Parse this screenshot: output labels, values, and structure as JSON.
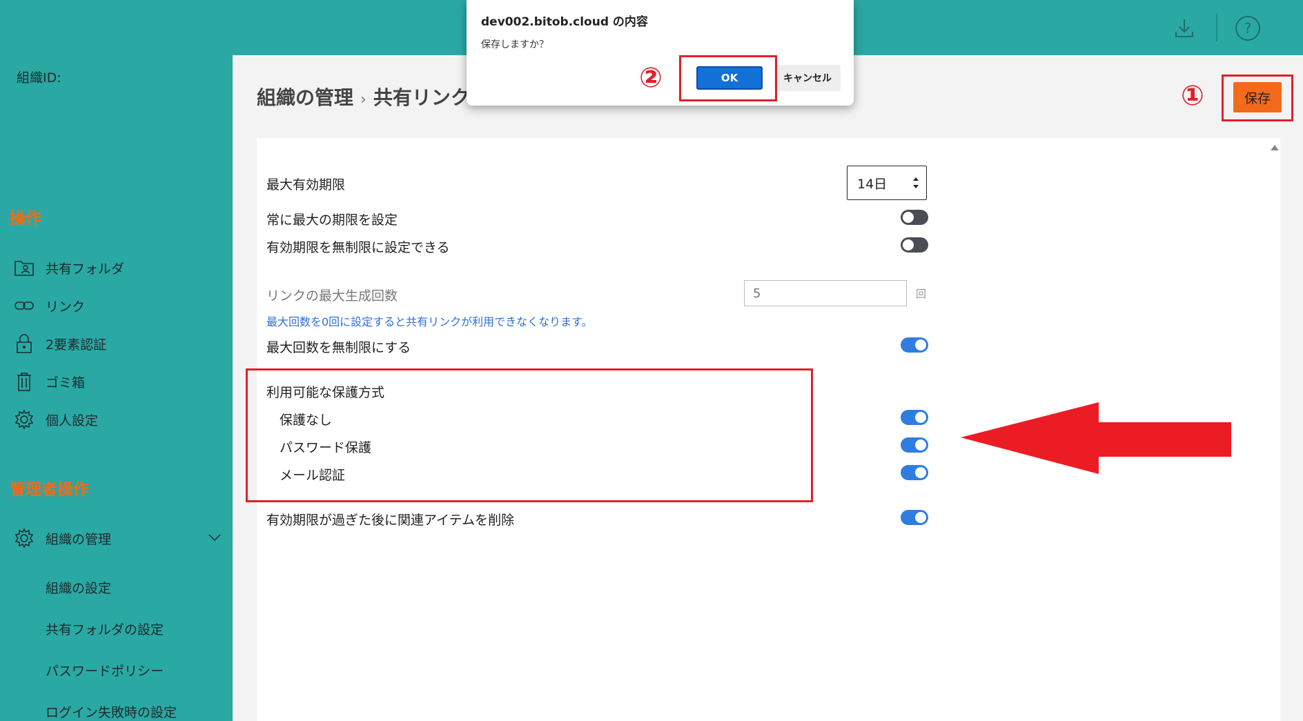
{
  "top_icons": {
    "download": "download-icon",
    "help": "help-icon"
  },
  "sidebar": {
    "org_id_label": "組織ID:",
    "section_ops": "操作",
    "items": [
      {
        "label": "共有フォルダ",
        "icon": "shared-folder-icon"
      },
      {
        "label": "リンク",
        "icon": "link-icon"
      },
      {
        "label": "2要素認証",
        "icon": "lock-icon"
      },
      {
        "label": "ゴミ箱",
        "icon": "trash-icon"
      },
      {
        "label": "個人設定",
        "icon": "gear-icon"
      }
    ],
    "section_admin": "管理者操作",
    "admin_item": {
      "label": "組織の管理",
      "icon": "gear-icon"
    },
    "admin_sub": [
      "組織の設定",
      "共有フォルダの設定",
      "パスワードポリシー",
      "ログイン失敗時の設定"
    ]
  },
  "breadcrumb": {
    "parent": "組織の管理",
    "separator": "›",
    "current": "共有リンク"
  },
  "save_button": "保存",
  "settings": {
    "max_expiry_label": "最大有効期限",
    "max_expiry_value": "14日",
    "always_max_label": "常に最大の期限を設定",
    "always_max_on": false,
    "unlimited_expiry_label": "有効期限を無制限に設定できる",
    "unlimited_expiry_on": false,
    "max_links_label": "リンクの最大生成回数",
    "max_links_value": "5",
    "max_links_unit": "回",
    "max_links_hint": "最大回数を0回に設定すると共有リンクが利用できなくなります。",
    "unlimited_count_label": "最大回数を無制限にする",
    "unlimited_count_on": true,
    "protection_title": "利用可能な保護方式",
    "protection_none": "保護なし",
    "protection_none_on": true,
    "protection_password": "パスワード保護",
    "protection_password_on": true,
    "protection_email": "メール認証",
    "protection_email_on": true,
    "delete_after_label": "有効期限が過ぎた後に関連アイテムを削除",
    "delete_after_on": true
  },
  "dialog": {
    "title": "dev002.bitob.cloud の内容",
    "message": "保存しますか？",
    "ok": "OK",
    "cancel": "キャンセル"
  },
  "annotations": {
    "step1": "①",
    "step2": "②"
  },
  "colors": {
    "accent_teal": "#2aa8a4",
    "orange": "#f26a1b",
    "toggle_on": "#2f7de1",
    "annotation_red": "#e02027"
  }
}
